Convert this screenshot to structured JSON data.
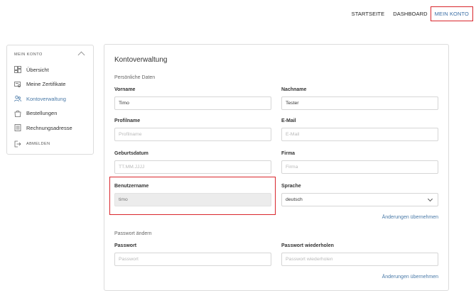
{
  "topnav": {
    "items": [
      "STARTSEITE",
      "DASHBOARD",
      "MEIN KONTO"
    ]
  },
  "sidebar": {
    "title": "MEIN KONTO",
    "items": [
      {
        "label": "Übersicht",
        "icon": "dashboard-icon"
      },
      {
        "label": "Meine Zertifikate",
        "icon": "certificate-icon"
      },
      {
        "label": "Kontoverwaltung",
        "icon": "users-icon"
      },
      {
        "label": "Bestellungen",
        "icon": "shopping-bag-icon"
      },
      {
        "label": "Rechnungsadresse",
        "icon": "address-card-icon"
      }
    ],
    "logout": "ABMELDEN"
  },
  "main": {
    "title": "Kontoverwaltung",
    "personal_section": "Persönliche Daten",
    "fields": {
      "vorname": {
        "label": "Vorname",
        "value": "Timo"
      },
      "nachname": {
        "label": "Nachname",
        "value": "Tester"
      },
      "profilname": {
        "label": "Profilname",
        "placeholder": "Profilname"
      },
      "email": {
        "label": "E-Mail",
        "placeholder": "E-Mail"
      },
      "geburtsdatum": {
        "label": "Geburtsdatum",
        "placeholder": "TT.MM.JJJJ"
      },
      "firma": {
        "label": "Firma",
        "placeholder": "Firma"
      },
      "benutzername": {
        "label": "Benutzername",
        "value": "timo"
      },
      "sprache": {
        "label": "Sprache",
        "value": "deutsch"
      }
    },
    "apply_changes": "Änderungen übernehmen",
    "password_section": "Passwort ändern",
    "password": {
      "label": "Passwort",
      "placeholder": "Passwort"
    },
    "password_repeat": {
      "label": "Passwort wiederholen",
      "placeholder": "Passwort wiederholen"
    },
    "apply_changes_2": "Änderungen übernehmen"
  },
  "colors": {
    "accent": "#4a7aa8",
    "highlight": "#d9262c",
    "border": "#dcdcdc"
  }
}
